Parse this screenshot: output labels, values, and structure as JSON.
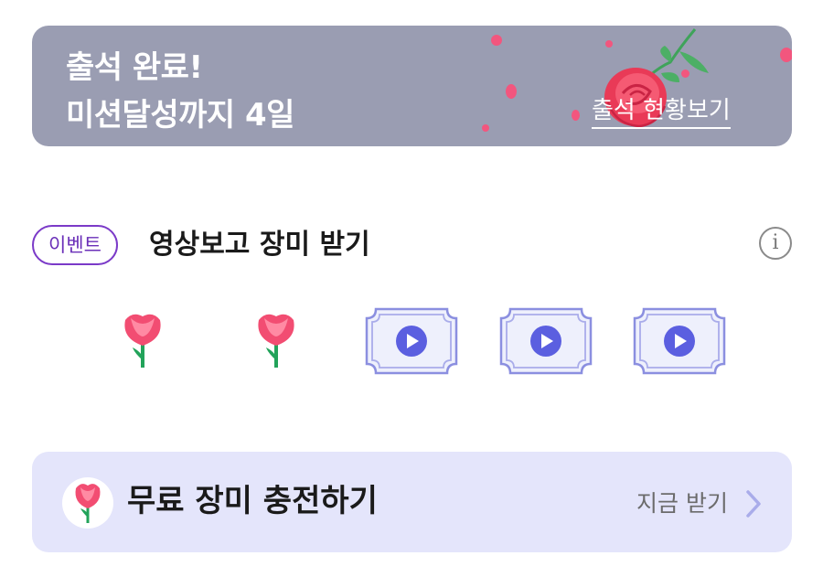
{
  "banner": {
    "line1": "출석 완료!",
    "line2": "미션달성까지 4일",
    "link_label": "출석 현황보기",
    "background": "#9a9db2"
  },
  "event": {
    "badge": "이벤트",
    "title": "영상보고 장미 받기",
    "info_label": "i",
    "slots": [
      {
        "state": "collected",
        "icon": "rose-icon"
      },
      {
        "state": "collected",
        "icon": "rose-icon"
      },
      {
        "state": "video",
        "icon": "play-icon"
      },
      {
        "state": "video",
        "icon": "play-icon"
      },
      {
        "state": "video",
        "icon": "play-icon"
      }
    ]
  },
  "charge": {
    "title": "무료 장미 충전하기",
    "action": "지금 받기",
    "icon": "rose-icon",
    "background": "#e4e5fb"
  },
  "colors": {
    "accent_purple": "#7b3ac8",
    "rose_red": "#f2567e",
    "ticket_border": "#8b8fe0",
    "play_blue": "#5b5fe0"
  }
}
